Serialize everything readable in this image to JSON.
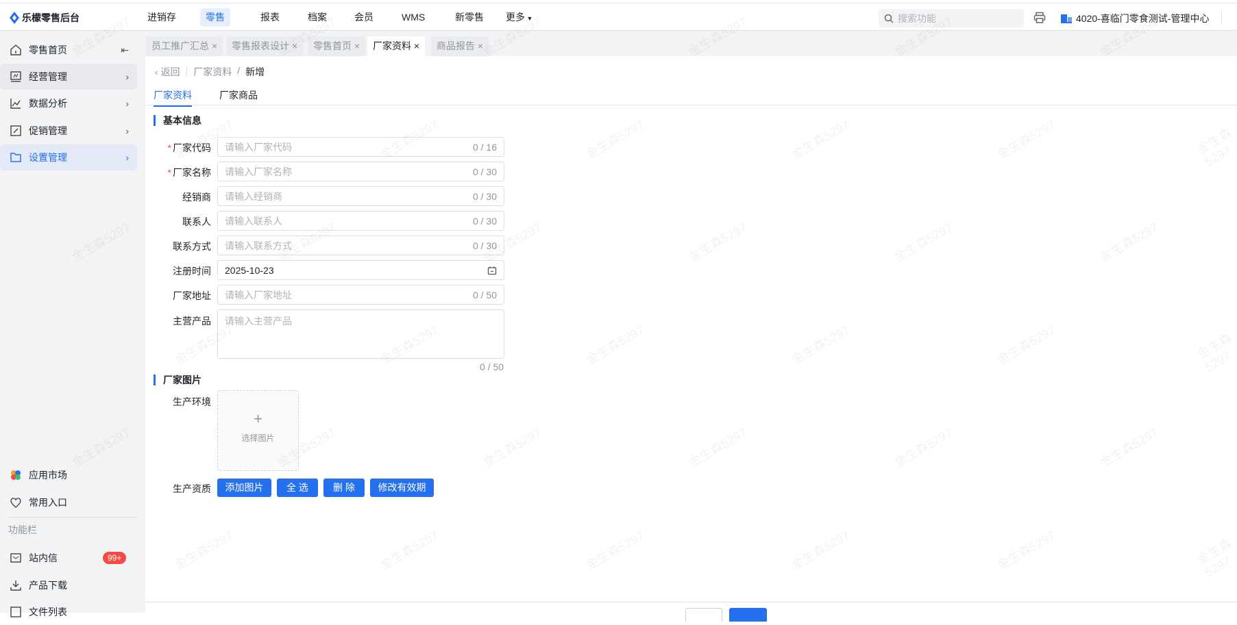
{
  "app": {
    "title": "乐檬零售后台"
  },
  "nav": [
    "进销存",
    "零售",
    "报表",
    "档案",
    "会员",
    "WMS",
    "新零售",
    "更多"
  ],
  "search": {
    "placeholder": "搜索功能"
  },
  "org": "4020-喜临门零食测试-管理中心",
  "sidebar": {
    "items": [
      "零售首页",
      "经营管理",
      "数据分析",
      "促销管理",
      "设置管理"
    ],
    "bottom": [
      "应用市场",
      "常用入口"
    ],
    "section": "功能栏",
    "tools": [
      "站内信",
      "产品下载",
      "文件列表"
    ],
    "badge": "99+"
  },
  "tabs": [
    "员工推广汇总",
    "零售报表设计",
    "零售首页",
    "厂家资料",
    "商品报告"
  ],
  "breadcrumb": {
    "back": "返回",
    "parent": "厂家资料",
    "current": "新增"
  },
  "subtabs": [
    "厂家资料",
    "厂家商品"
  ],
  "form": {
    "section1": "基本信息",
    "fields": [
      {
        "label": "厂家代码",
        "placeholder": "请输入厂家代码",
        "count": "0 / 16",
        "required": true
      },
      {
        "label": "厂家名称",
        "placeholder": "请输入厂家名称",
        "count": "0 / 30",
        "required": true
      },
      {
        "label": "经销商",
        "placeholder": "请输入经销商",
        "count": "0 / 30"
      },
      {
        "label": "联系人",
        "placeholder": "请输入联系人",
        "count": "0 / 30"
      },
      {
        "label": "联系方式",
        "placeholder": "请输入联系方式",
        "count": "0 / 30"
      },
      {
        "label": "注册时间",
        "value": "2025-10-23"
      },
      {
        "label": "厂家地址",
        "placeholder": "请输入厂家地址",
        "count": "0 / 50"
      }
    ],
    "product": {
      "label": "主营产品",
      "placeholder": "请输入主营产品",
      "count": "0 / 50"
    },
    "section2": "厂家图片",
    "env_label": "生产环境",
    "upload_text": "选择图片",
    "upload_plus": "+",
    "qual_label": "生产资质",
    "buttons": [
      "添加图片",
      "全 选",
      "删 除",
      "修改有效期"
    ]
  },
  "watermark": "金生森5297"
}
